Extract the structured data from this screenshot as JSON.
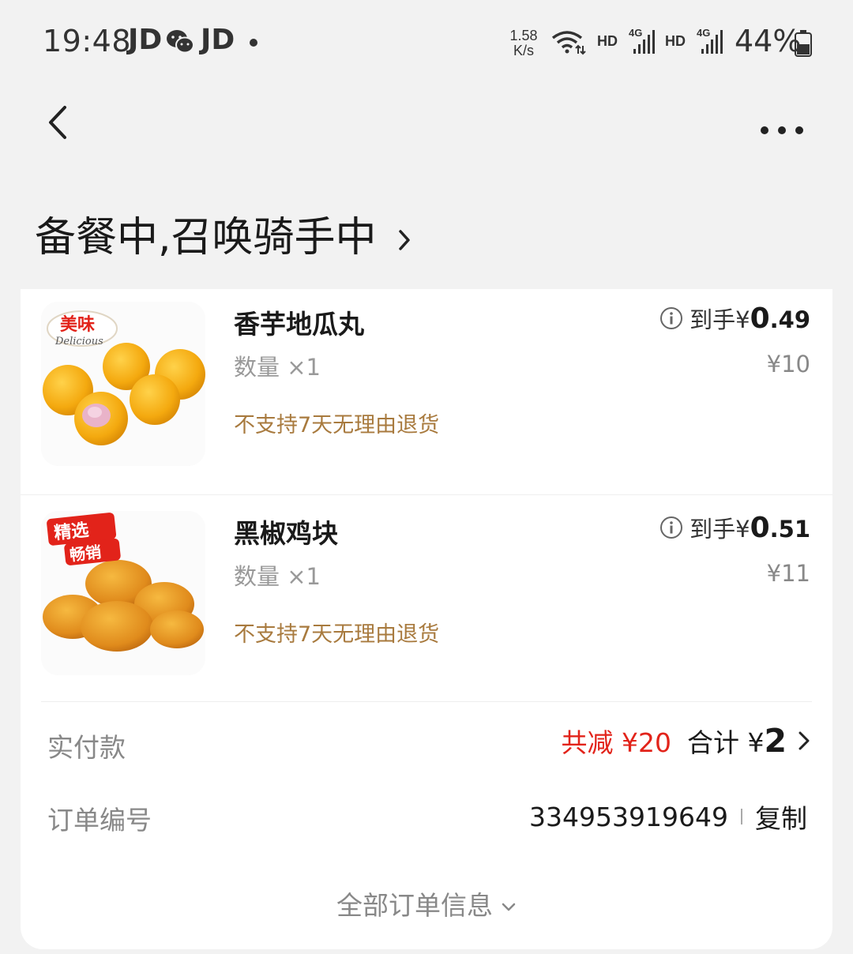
{
  "status_bar": {
    "time": "19:48",
    "apps": [
      "JD",
      "JD"
    ],
    "speed_value": "1.58",
    "speed_unit": "K/s",
    "hd_1": "HD",
    "hd_2": "HD",
    "net_1": "4G",
    "net_2": "4G",
    "battery": "44%"
  },
  "header": {
    "status": "备餐中,召唤骑手中"
  },
  "items": [
    {
      "name": "香芋地瓜丸",
      "qty": "数量 ×1",
      "note": "不支持7天无理由退货",
      "price_label": "到手¥",
      "price_int": "0",
      "price_dec": ".49",
      "orig_price": "¥10",
      "badge": "美味",
      "badge_sub": "Delicious",
      "image": "taro-sweet-potato-balls"
    },
    {
      "name": "黑椒鸡块",
      "qty": "数量 ×1",
      "note": "不支持7天无理由退货",
      "price_label": "到手¥",
      "price_int": "0",
      "price_dec": ".51",
      "orig_price": "¥11",
      "badge": "精选",
      "badge_sub": "畅销",
      "image": "black-pepper-chicken-nuggets"
    }
  ],
  "payment": {
    "label": "实付款",
    "discount": "共减 ¥20",
    "total_label": "合计 ¥",
    "total": "2"
  },
  "order": {
    "label": "订单编号",
    "id": "334953919649",
    "copy": "复制"
  },
  "all_info": "全部订单信息",
  "colors": {
    "discount": "#e2231a",
    "note": "#a87a3e",
    "background": "#f2f2f2"
  }
}
